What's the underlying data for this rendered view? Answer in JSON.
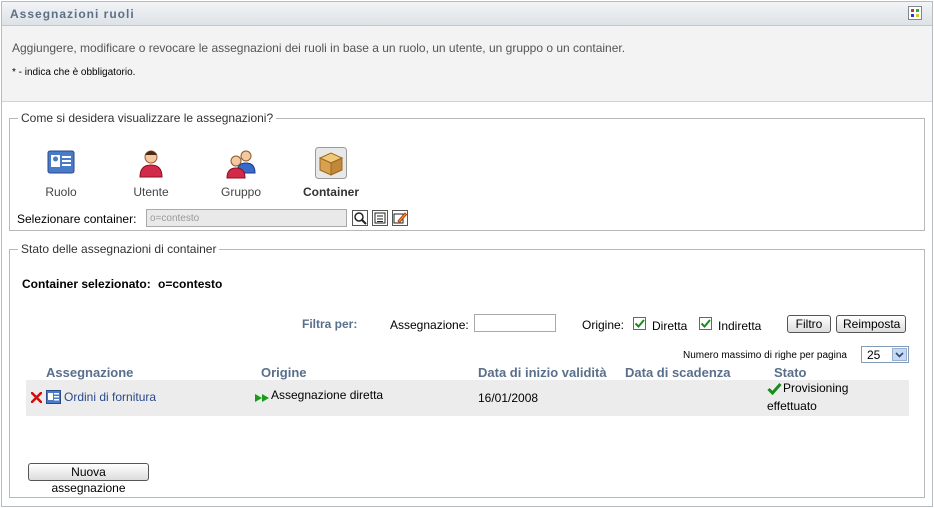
{
  "header": {
    "title": "Assegnazioni ruoli"
  },
  "intro": {
    "description": "Aggiungere, modificare o revocare le assegnazioni dei ruoli in base a un ruolo, un utente, un gruppo o un container.",
    "required_note": "* - indica che è obbligatorio."
  },
  "view": {
    "legend": "Come si desidera visualizzare le assegnazioni?",
    "options": [
      {
        "label": "Ruolo",
        "icon": "role-card-icon"
      },
      {
        "label": "Utente",
        "icon": "user-icon"
      },
      {
        "label": "Gruppo",
        "icon": "group-icon"
      },
      {
        "label": "Container",
        "icon": "container-box-icon"
      }
    ],
    "selected": "Container",
    "container_label": "Selezionare container:",
    "container_value": "o=contesto"
  },
  "status": {
    "legend": "Stato delle assegnazioni di container",
    "selected_label": "Container selezionato:",
    "selected_value": "o=contesto",
    "filter_label": "Filtra per:",
    "assignment_label": "Assegnazione:",
    "assignment_value": "",
    "origin_label": "Origine:",
    "direct_label": "Diretta",
    "indirect_label": "Indiretta",
    "filter_button": "Filtro",
    "reset_button": "Reimposta",
    "max_rows_label": "Numero massimo di righe per pagina",
    "max_rows_value": "25",
    "columns": [
      "Assegnazione",
      "Origine",
      "Data di inizio validità",
      "Data di scadenza",
      "Stato"
    ],
    "rows": [
      {
        "assignment": "Ordini di fornitura",
        "origin": "Assegnazione diretta",
        "start": "16/01/2008",
        "end": "",
        "status_line1": "Provisioning",
        "status_line2": "effettuato"
      }
    ],
    "new_button": "Nuova assegnazione"
  },
  "colors": {
    "accent": "#5a6f8b",
    "link": "#2a4a8a",
    "check": "#1a8a1a",
    "delete": "#cc1111"
  }
}
